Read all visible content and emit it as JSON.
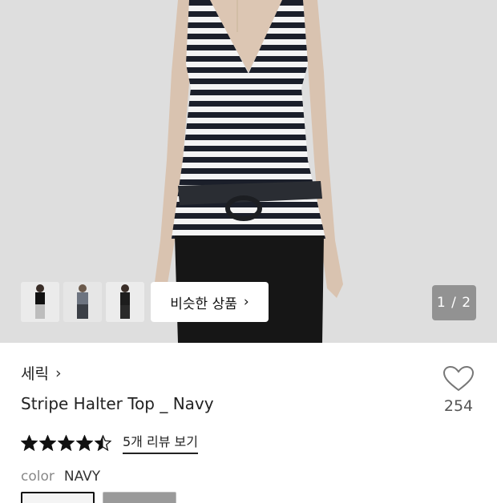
{
  "gallery": {
    "similar_button_label": "비슷한 상품",
    "pager": "1 / 2",
    "thumbnails": [
      "black-top-thumbnail",
      "gray-top-thumbnail",
      "black-tank-thumbnail"
    ]
  },
  "product": {
    "brand": "세릭",
    "title": "Stripe Halter Top _ Navy",
    "like_count": "254",
    "rating": 4.5,
    "review_link": "5개 리뷰 보기",
    "color_label": "color",
    "color_value": "NAVY"
  },
  "colors": {
    "star": "#111111",
    "background_photo": "#dedede",
    "pager_bg": "#7a7a7a"
  }
}
